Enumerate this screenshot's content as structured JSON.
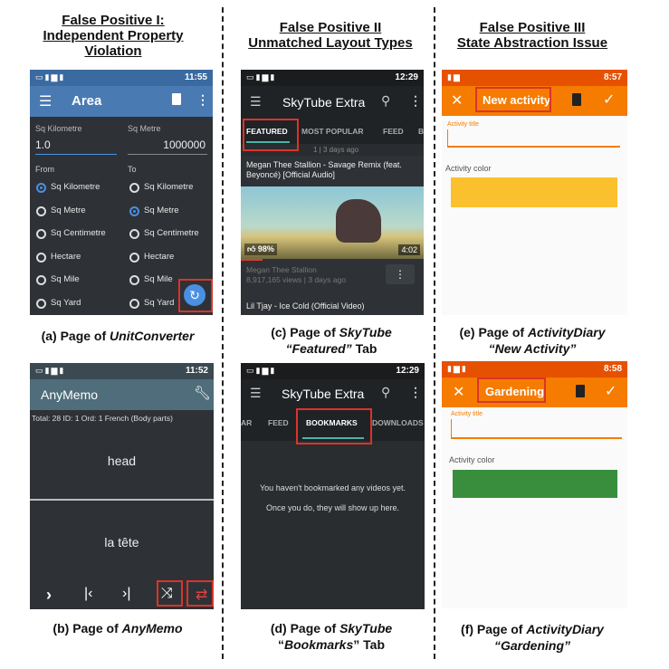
{
  "headers": {
    "fp1": [
      "False Positive I:",
      "Independent Property",
      "Violation"
    ],
    "fp2": [
      "False Positive II",
      "Unmatched Layout Types"
    ],
    "fp3": [
      "False Positive III",
      "State Abstraction Issue"
    ]
  },
  "captions": {
    "a": {
      "prefix": "(a) Page of ",
      "italic": "UnitConverter"
    },
    "b": {
      "prefix": "(b) Page of ",
      "italic": "AnyMemo"
    },
    "c": {
      "line1_prefix": "(c) Page of ",
      "line1_italic": "SkyTube",
      "line2_italic": "“Featured”",
      "line2_suffix": " Tab"
    },
    "d": {
      "line1_prefix": "(d) Page of ",
      "line1_italic": "SkyTube",
      "line2_prefix": "“",
      "line2_italic": "Bookmarks",
      "line2_suffix": "” Tab"
    },
    "e": {
      "line1_prefix": "(e) Page of ",
      "line1_italic": "ActivityDiary",
      "line2_italic": "“New Activity”"
    },
    "f": {
      "line1_prefix": "(f) Page of ",
      "line1_italic": "ActivityDiary",
      "line2_italic": "“Gardening”"
    }
  },
  "colors": {
    "blue_bar": "#4a7ab2",
    "dark_bg": "#2e3236",
    "skytube_bar": "#1f2326",
    "anymemo_bar": "#4f6d7a",
    "orange": "#f57c00",
    "yellow_swatch": "#fbc02d",
    "green_swatch": "#388e3c",
    "highlight": "#d9342b"
  },
  "unitconverter": {
    "time": "11:55",
    "title": "Area",
    "sq_km_label": "Sq Kilometre",
    "sq_m_label": "Sq Metre",
    "value_left": "1.0",
    "value_right": "1000000",
    "from_label": "From",
    "to_label": "To",
    "from_options": [
      "Sq Kilometre",
      "Sq Metre",
      "Sq Centimetre",
      "Hectare",
      "Sq Mile",
      "Sq Yard"
    ],
    "to_options": [
      "Sq Kilometre",
      "Sq Metre",
      "Sq Centimetre",
      "Hectare",
      "Sq Mile",
      "Sq Yard"
    ],
    "from_selected": 0,
    "to_selected": 1,
    "icons": [
      "menu-icon",
      "trash-icon",
      "overflow-icon",
      "swap-icon"
    ]
  },
  "anymemo": {
    "time": "11:52",
    "title": "AnyMemo",
    "info": "Total: 28 ID: 1 Ord: 1 French (Body parts)",
    "front": "head",
    "back": "la tête",
    "icons": [
      "next-icon",
      "first-icon",
      "last-icon",
      "shuffle-icon",
      "repeat-icon",
      "wrench-icon"
    ]
  },
  "skytube_featured": {
    "time": "12:29",
    "title": "SkyTube Extra",
    "tabs": [
      "FEATURED",
      "MOST POPULAR",
      "FEED",
      "B"
    ],
    "video1_meta": "1 | 3 days ago",
    "video2_title": "Megan Thee Stallion - Savage Remix (feat. Beyoncé) [Official Audio]",
    "video2_likes": "98%",
    "video2_duration": "4:02",
    "video2_channel": "Megan Thee Stallion",
    "video2_stats": "8,917,165 views  |  3 days ago",
    "video3_title": "Lil Tjay - Ice Cold (Official Video)"
  },
  "skytube_bookmarks": {
    "time": "12:29",
    "title": "SkyTube Extra",
    "tabs": [
      "AR",
      "FEED",
      "BOOKMARKS",
      "DOWNLOADS"
    ],
    "empty_line1": "You haven't bookmarked any videos yet.",
    "empty_line2": "Once you do, they will show up here."
  },
  "activity_new": {
    "time": "8:57",
    "title": "New activity",
    "field_label": "Activity title",
    "color_label": "Activity color"
  },
  "activity_gardening": {
    "time": "8:58",
    "title": "Gardening",
    "field_label": "Activity title",
    "color_label": "Activity color"
  }
}
